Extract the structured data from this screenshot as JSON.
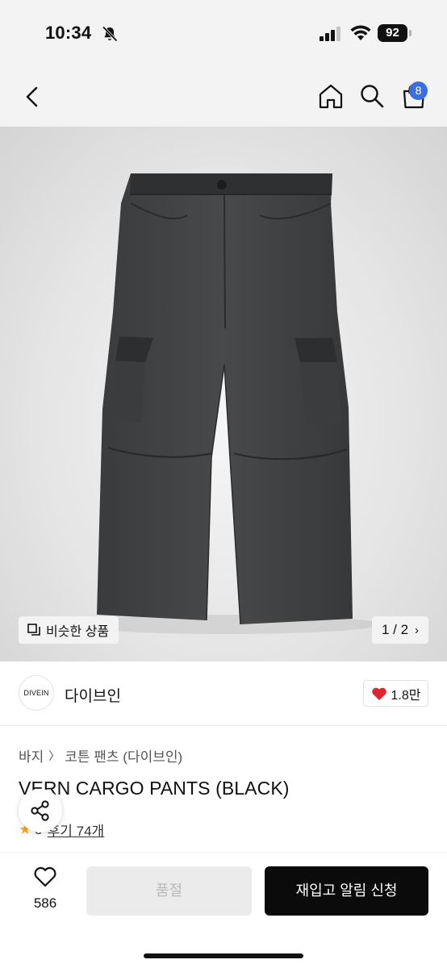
{
  "status_bar": {
    "time": "10:34",
    "battery": "92",
    "icons": [
      "bell-slash-icon",
      "signal-icon",
      "wifi-icon",
      "battery-icon"
    ]
  },
  "nav": {
    "icons": [
      "chevron-left-icon",
      "home-icon",
      "search-icon",
      "cart-icon"
    ],
    "cart_count": "8"
  },
  "gallery": {
    "similar_label": "비슷한 상품",
    "pager": "1 / 2"
  },
  "brand": {
    "logo_text": "DIVEIN",
    "name": "다이브인",
    "likes": "1.8만"
  },
  "breadcrumb": {
    "category": "바지",
    "subcategory": "코튼 팬츠 (다이브인)"
  },
  "product": {
    "title": "VERN CARGO PANTS (BLACK)",
    "rating_value": "5",
    "reviews_label": "후기 74개"
  },
  "bottom_bar": {
    "wish_count": "586",
    "soldout_label": "품절",
    "restock_label": "재입고 알림 신청"
  },
  "colors": {
    "accent_badge": "#3d6ee0",
    "heart": "#e0242f",
    "cta": "#0b0b0b",
    "star": "#f5a623"
  }
}
